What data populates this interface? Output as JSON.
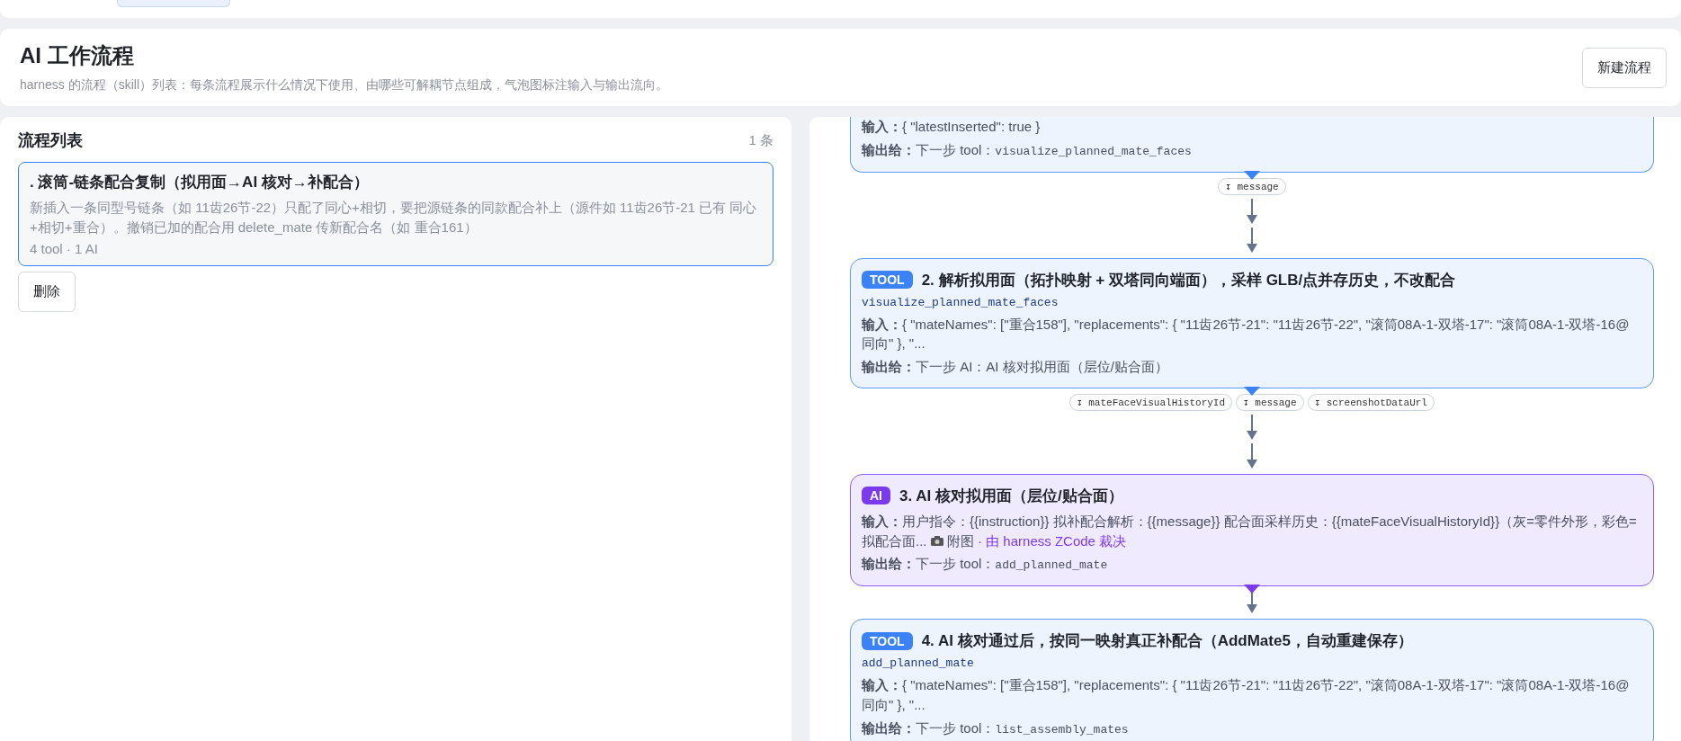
{
  "header": {
    "title": "AI 工作流程",
    "subtitle": "harness 的流程（skill）列表：每条流程展示什么情况下使用、由哪些可解耦节点组成，气泡图标注输入与输出流向。",
    "new_button": "新建流程"
  },
  "flow_list": {
    "title": "流程列表",
    "count": "1 条",
    "items": [
      {
        "title": ". 滚筒-链条配合复制（拟用面→AI 核对→补配合）",
        "description": "新插入一条同型号链条（如 11齿26节-22）只配了同心+相切，要把源链条的同款配合补上（源件如 11齿26节-21 已有 同心+相切+重合）。撤销已加的配合用 delete_mate 传新配合名（如 重合161）",
        "meta": "4 tool · 1 AI",
        "selected": true
      }
    ],
    "delete_button": "删除"
  },
  "nodes": [
    {
      "kind": "tool",
      "input_label": "输入：",
      "input": "{ \"latestInserted\": true }",
      "output_label": "输出给：",
      "output_prefix": "下一步 tool：",
      "output_code": "visualize_planned_mate_faces",
      "pills": [
        "↧ message"
      ]
    },
    {
      "kind": "tool",
      "badge": "TOOL",
      "title": "2. 解析拟用面（拓扑映射 + 双塔同向端面），采样 GLB/点并存历史，不改配合",
      "function": "visualize_planned_mate_faces",
      "input_label": "输入：",
      "input": "{ \"mateNames\": [\"重合158\"], \"replacements\": { \"11齿26节-21\": \"11齿26节-22\", \"滚筒08A-1-双塔-17\": \"滚筒08A-1-双塔-16@同向\" }, \"...",
      "output_label": "输出给：",
      "output_prefix": "下一步 AI：",
      "output_text": "AI 核对拟用面（层位/贴合面）",
      "pills": [
        "↧ mateFaceVisualHistoryId",
        "↧ message",
        "↧ screenshotDataUrl"
      ]
    },
    {
      "kind": "ai",
      "badge": "AI",
      "title": "3. AI 核对拟用面（层位/贴合面）",
      "input_label": "输入：",
      "input": "用户指令：{{instruction}} 拟补配合解析：{{message}} 配合面采样历史：{{mateFaceVisualHistoryId}}（灰=零件外形，彩色=拟配合面...",
      "attachment": "附图",
      "note": "· 由 harness ZCode 裁决",
      "output_label": "输出给：",
      "output_prefix": "下一步 tool：",
      "output_code": "add_planned_mate"
    },
    {
      "kind": "tool",
      "badge": "TOOL",
      "title": "4. AI 核对通过后，按同一映射真正补配合（AddMate5，自动重建保存）",
      "function": "add_planned_mate",
      "input_label": "输入：",
      "input": "{ \"mateNames\": [\"重合158\"], \"replacements\": { \"11齿26节-21\": \"11齿26节-22\", \"滚筒08A-1-双塔-17\": \"滚筒08A-1-双塔-16@同向\" }, \"...",
      "output_label": "输出给：",
      "output_prefix": "下一步 tool：",
      "output_code": "list_assembly_mates"
    }
  ]
}
